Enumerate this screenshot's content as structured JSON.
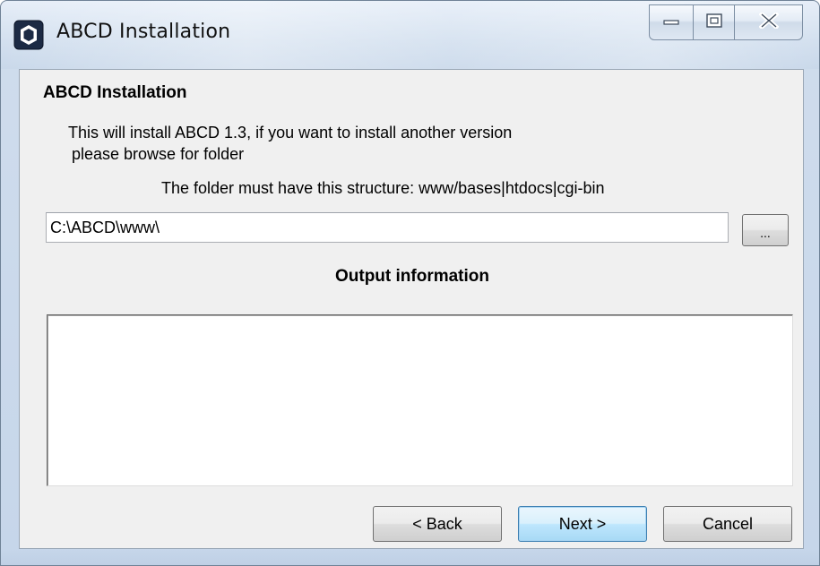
{
  "window": {
    "title": "ABCD Installation"
  },
  "icons": {
    "app": "app-icon",
    "minimize": "minimize-icon",
    "maximize": "maximize-icon",
    "close": "close-icon"
  },
  "content": {
    "heading": "ABCD Installation",
    "description_line1": "This will install ABCD 1.3, if you want to install another version",
    "description_line2": "please browse for folder",
    "structure_note": "The folder must have this structure: www/bases|htdocs|cgi-bin",
    "path_value": "C:\\ABCD\\www\\",
    "browse_label": "...",
    "output_heading": "Output information",
    "output_text": ""
  },
  "buttons": {
    "back": "< Back",
    "next": "Next >",
    "cancel": "Cancel"
  },
  "colors": {
    "titlebar": "#d3e0ef",
    "client_background": "#f0f0f0",
    "default_button_border": "#3c7fb1"
  }
}
